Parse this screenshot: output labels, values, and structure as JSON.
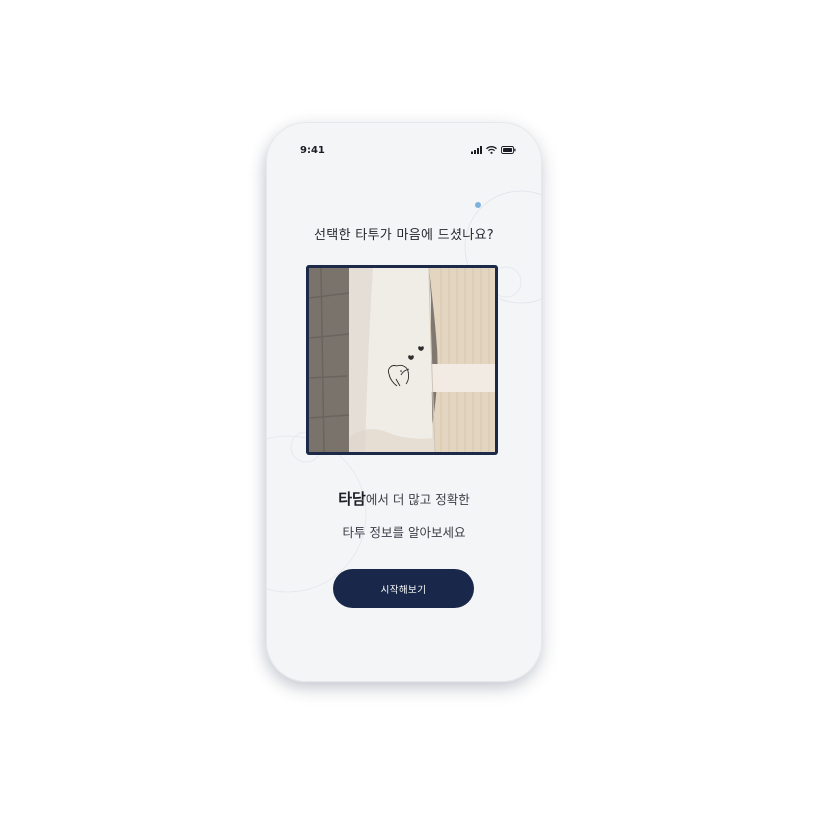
{
  "status_bar": {
    "time": "9:41",
    "icons": [
      "signal-icon",
      "wifi-icon",
      "battery-icon"
    ]
  },
  "screen": {
    "title": "선택한 타투가 마음에 드셨나요?",
    "image": {
      "subject": "forearm with small fine-line dog and butterfly tattoo"
    },
    "subtitle_brand": "타담",
    "subtitle_line1_rest": "에서 더 많고 정확한",
    "subtitle_line2": "타투 정보를 알아보세요",
    "start_button_label": "시작해보기"
  },
  "colors": {
    "accent": "#19284A",
    "frame": "#1D2A47",
    "dot": "#7FB2DB",
    "screen_bg": "#F4F5F7"
  }
}
